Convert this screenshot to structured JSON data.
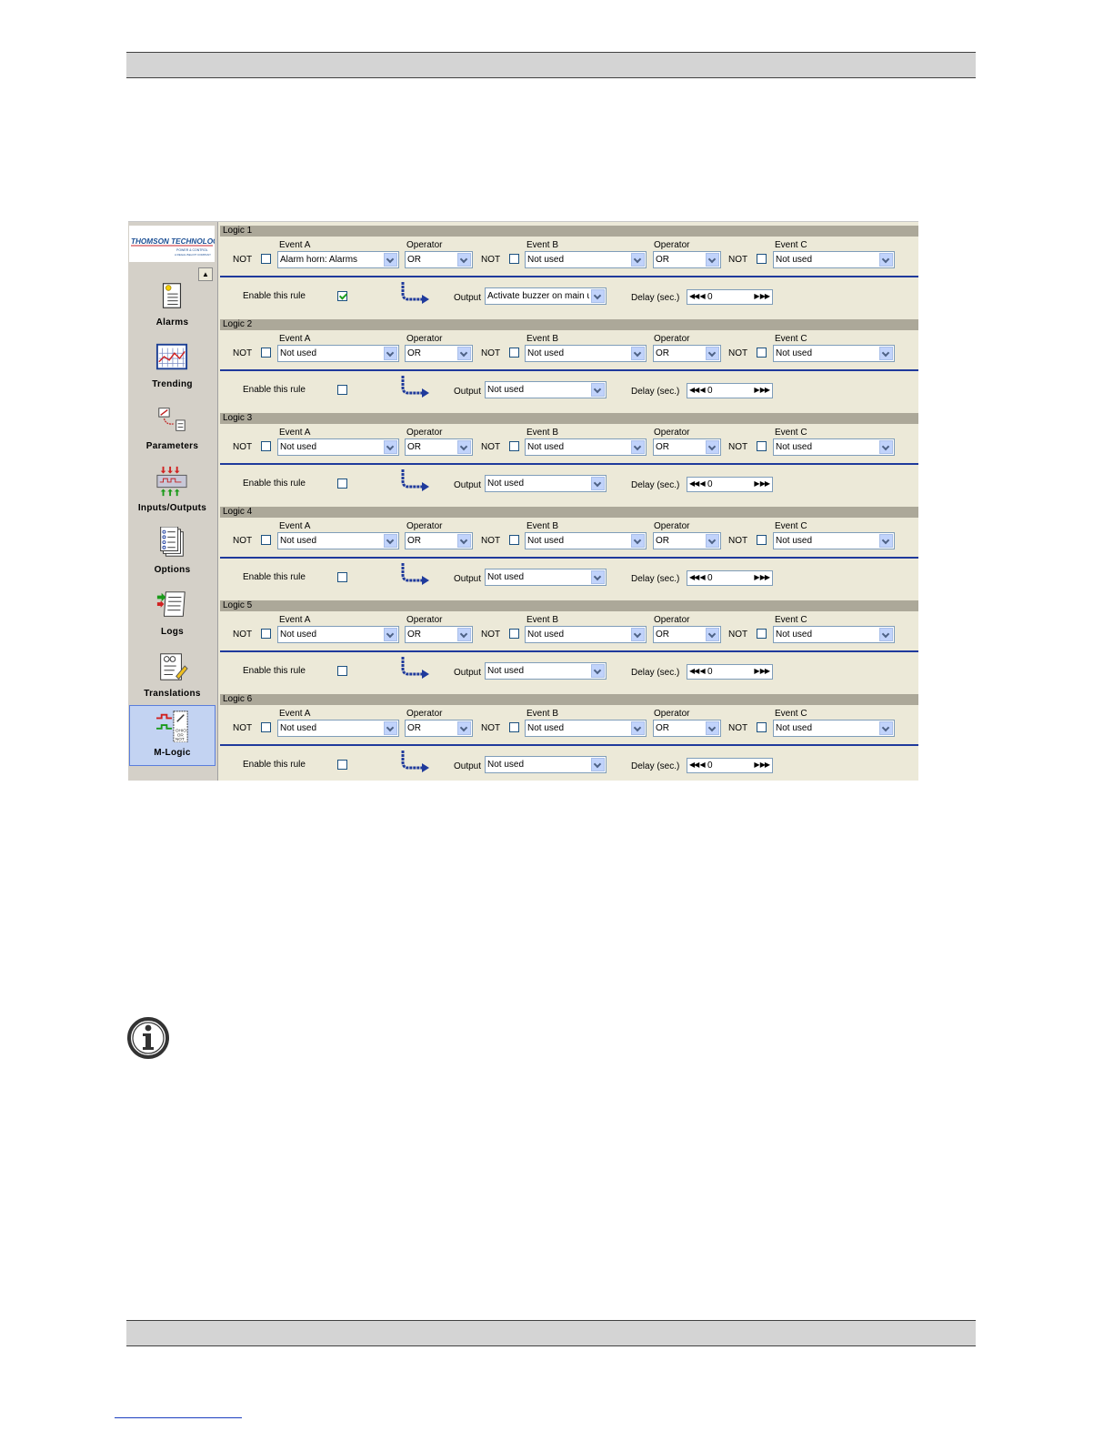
{
  "sidebar": {
    "logo": {
      "name": "THOMSON TECHNOLOGY",
      "tagline": "POWER & CONTROL",
      "subtag": "A REGAL BELOIT COMPANY"
    },
    "items": [
      {
        "label": "Alarms",
        "icon": "alarm-bell-icon",
        "active": false
      },
      {
        "label": "Trending",
        "icon": "trending-chart-icon",
        "active": false
      },
      {
        "label": "Parameters",
        "icon": "parameters-icon",
        "active": false
      },
      {
        "label": "Inputs/Outputs",
        "icon": "inputs-outputs-icon",
        "active": false
      },
      {
        "label": "Options",
        "icon": "options-list-icon",
        "active": false
      },
      {
        "label": "Logs",
        "icon": "logs-icon",
        "active": false
      },
      {
        "label": "Translations",
        "icon": "translations-icon",
        "active": false
      },
      {
        "label": "M-Logic",
        "icon": "m-logic-icon",
        "active": true
      }
    ]
  },
  "labels": {
    "not": "NOT",
    "event_a": "Event A",
    "event_b": "Event B",
    "event_c": "Event C",
    "operator": "Operator",
    "enable": "Enable this rule",
    "output": "Output",
    "delay": "Delay (sec.)",
    "logic_not": "NOT",
    "logic_or": "OR"
  },
  "logics": [
    {
      "title": "Logic 1",
      "event_a": "Alarm horn: Alarms",
      "operator1": "OR",
      "event_b": "Not used",
      "operator2": "OR",
      "event_c": "Not used",
      "enabled": true,
      "output": "Activate buzzer on main u",
      "delay": "0"
    },
    {
      "title": "Logic 2",
      "event_a": "Not used",
      "operator1": "OR",
      "event_b": "Not used",
      "operator2": "OR",
      "event_c": "Not used",
      "enabled": false,
      "output": "Not used",
      "delay": "0"
    },
    {
      "title": "Logic 3",
      "event_a": "Not used",
      "operator1": "OR",
      "event_b": "Not used",
      "operator2": "OR",
      "event_c": "Not used",
      "enabled": false,
      "output": "Not used",
      "delay": "0"
    },
    {
      "title": "Logic 4",
      "event_a": "Not used",
      "operator1": "OR",
      "event_b": "Not used",
      "operator2": "OR",
      "event_c": "Not used",
      "enabled": false,
      "output": "Not used",
      "delay": "0"
    },
    {
      "title": "Logic 5",
      "event_a": "Not used",
      "operator1": "OR",
      "event_b": "Not used",
      "operator2": "OR",
      "event_c": "Not used",
      "enabled": false,
      "output": "Not used",
      "delay": "0"
    },
    {
      "title": "Logic 6",
      "event_a": "Not used",
      "operator1": "OR",
      "event_b": "Not used",
      "operator2": "OR",
      "event_c": "Not used",
      "enabled": false,
      "output": "Not used",
      "delay": "0"
    }
  ],
  "colors": {
    "accent_blue": "#1f3a9c",
    "window_bg": "#ece9d8",
    "header_bar": "#aca899"
  }
}
